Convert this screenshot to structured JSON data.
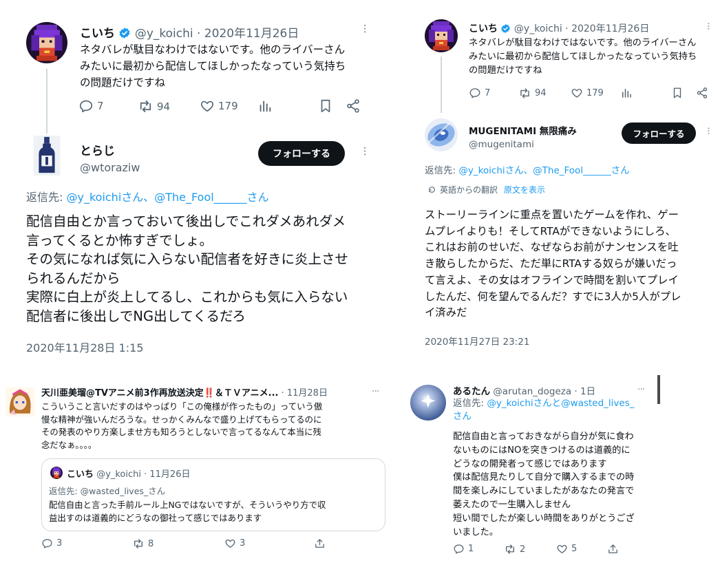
{
  "panel_a": {
    "tweet": {
      "name": "こいち",
      "handle": "@y_koichi",
      "date": "· 2020年11月26日",
      "text": "ネタバレが駄目なわけではないです。他のライバーさん\nみたいに最初から配信してほしかったなっていう気持ち\nの問題だけですね",
      "replies": "7",
      "retweets": "94",
      "likes": "179"
    },
    "reply": {
      "name": "とらじ",
      "handle": "@wtoraziw",
      "follow_label": "フォローする",
      "reply_to_prefix": "返信先: ",
      "reply_to_mentions": "@y_koichiさん、@The_Fool______さん",
      "text": "配信自由とか言っておいて後出しでこれダメあれダメ\n言ってくるとか怖すぎでしょ。\nその気になれば気に入らない配信者を好きに炎上させ\nられるんだから\n実際に白上が炎上してるし、これからも気に入らない\n配信者に後出しでNG出してくるだろ",
      "timestamp": "2020年11月28日 1:15"
    }
  },
  "panel_b": {
    "tweet": {
      "name": "こいち",
      "handle": "@y_koichi",
      "date": "· 2020年11月26日",
      "text": "ネタバレが駄目なわけではないです。他のライバーさん\nみたいに最初から配信してほしかったなっていう気持ち\nの問題だけですね",
      "replies": "7",
      "retweets": "94",
      "likes": "179"
    },
    "reply": {
      "name": "MUGENITAMI 無限痛み",
      "handle": "@mugenitami",
      "follow_label": "フォローする",
      "reply_to_prefix": "返信先: ",
      "reply_to_mentions": "@y_koichiさん、@The_Fool______さん",
      "translated_label": "英語からの翻訳",
      "show_original": "原文を表示",
      "text": "ストーリーラインに重点を置いたゲームを作れ、ゲー\nムプレイよりも！そしてRTAができないようにしろ、\nこれはお前のせいだ、なぜならお前がナンセンスを吐\nき散らしたからだ、ただ単にRTAする奴らが嫌いだっ\nて言えよ、その女はオフラインで時間を割いてプレイ\nしたんだ、何を望んでるんだ？すでに3人か5人がプレ\nイ済みだ",
      "timestamp": "2020年11月27日 23:21"
    }
  },
  "panel_c": {
    "name": "天川亜美瑠@TVアニメ前3作再放送決定‼️＆ＴＶアニメ...",
    "date": "· 11月28日",
    "text": "こういうこと言いだすのはやっぱり「この俺様が作ったもの」っていう傲\n慢な精神が強いんだろうな。せっかくみんなで盛り上げてもらってるのに\nその発表のやり方楽しませ方も知ろうとしないで言ってるなんて本当に残\n念だなぁ。。。。",
    "quote": {
      "name": "こいち",
      "handle": "@y_koichi",
      "date": "· 11月26日",
      "reply_to": "返信先: @wasted_lives_さん",
      "text": "配信自由と言った手前ルール上NGではないですが、そういうやり方で収\n益出すのは道義的にどうなの御社って感じではあります"
    },
    "replies": "3",
    "retweets": "8",
    "likes": "3"
  },
  "panel_d": {
    "name": "あるたん",
    "handle": "@arutan_dogeza",
    "date": "· 1日",
    "reply_to_prefix": "返信先: ",
    "reply_to_line1": "@y_koichiさんと@wasted_lives_",
    "reply_to_line2": "さん",
    "text": "配信自由と言っておきながら自分が気に食わ\nないものにはNOを突きつけるのは道義的に\nどうなの開発者って感じではあります\n僕は配信見たりして自分で購入するまでの時\n間を楽しみにしていましたがあなたの発言で\n萎えたので一生購入しません\n短い間でしたが楽しい時間をありがとうござ\nいました。",
    "replies": "1",
    "retweets": "2",
    "likes": "5"
  },
  "colors": {
    "link": "#1d9bf0",
    "muted": "#536471",
    "follow_bg": "#0f1419",
    "verified": "#1d9bf0"
  }
}
